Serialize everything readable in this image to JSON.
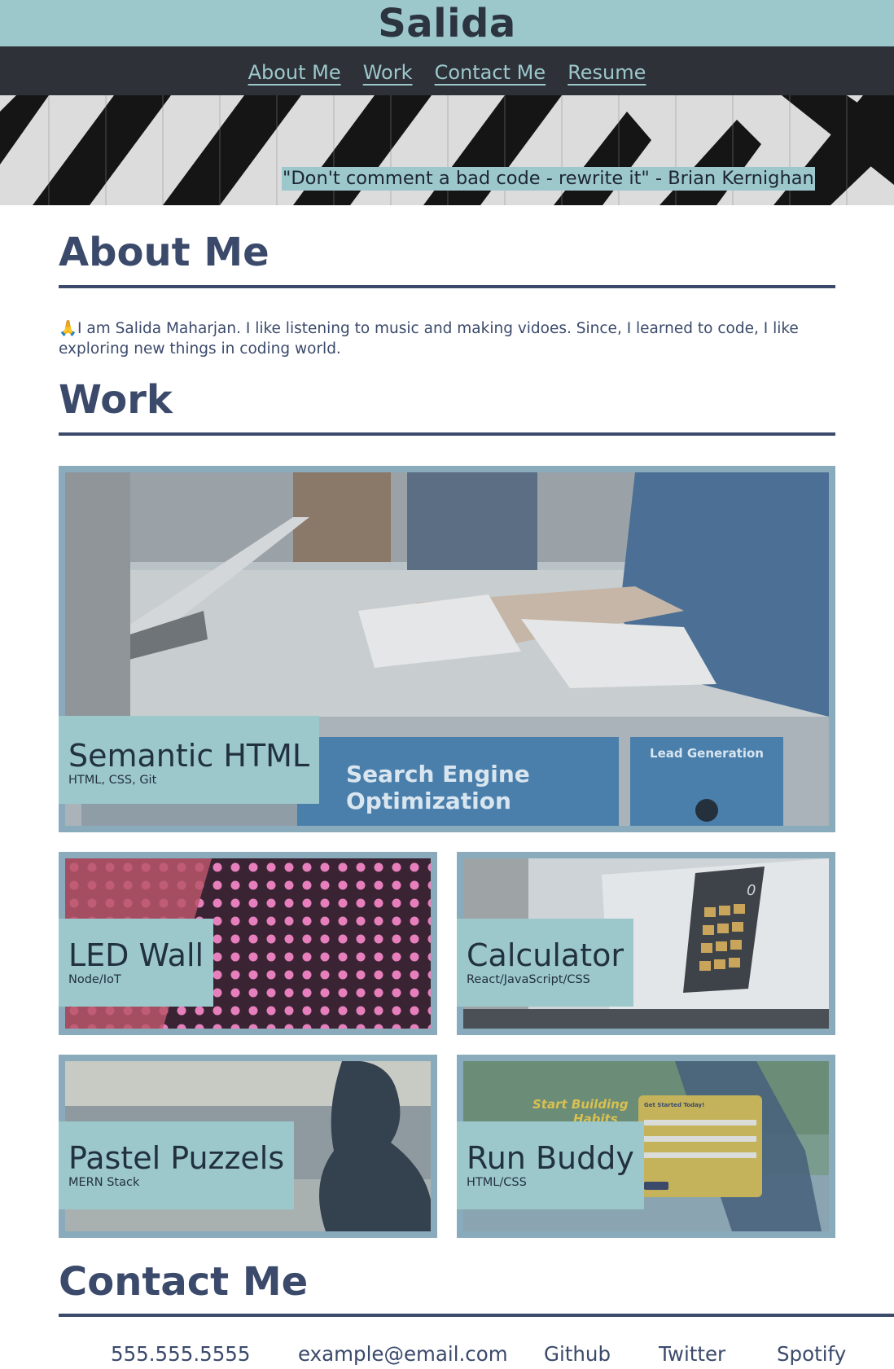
{
  "header": {
    "title": "Salida"
  },
  "nav": {
    "items": [
      "About Me",
      "Work",
      "Contact Me",
      "Resume"
    ]
  },
  "hero": {
    "quote": "\"Don't comment a bad code - rewrite it\" - Brian Kernighan"
  },
  "about": {
    "heading": "About Me",
    "emoji": "🙏",
    "text": "I am Salida Maharjan. I like listening to music and making vidoes. Since, I learned to code, I like exploring new things in coding world."
  },
  "work": {
    "heading": "Work",
    "projects": [
      {
        "name": "Semantic HTML",
        "tech": "HTML, CSS, Git",
        "image_text": [
          "Search Engine",
          "Optimization",
          "Lead Generation"
        ]
      },
      {
        "name": "LED Wall",
        "tech": "Node/IoT"
      },
      {
        "name": "Calculator",
        "tech": "React/JavaScript/CSS",
        "image_text": [
          "0"
        ]
      },
      {
        "name": "Pastel Puzzels",
        "tech": "MERN Stack"
      },
      {
        "name": "Run Buddy",
        "tech": "HTML/CSS",
        "image_text": [
          "Start Building",
          "Habits",
          "Get Started Today!"
        ]
      }
    ]
  },
  "contact": {
    "heading": "Contact Me",
    "items": [
      "555.555.5555",
      "example@email.com",
      "Github",
      "Twitter",
      "Spotify"
    ]
  },
  "colors": {
    "accent": "#9cc8cc",
    "nav_bg": "#2e3138",
    "heading": "#3b4a6b",
    "card_frame": "#89abbb"
  }
}
